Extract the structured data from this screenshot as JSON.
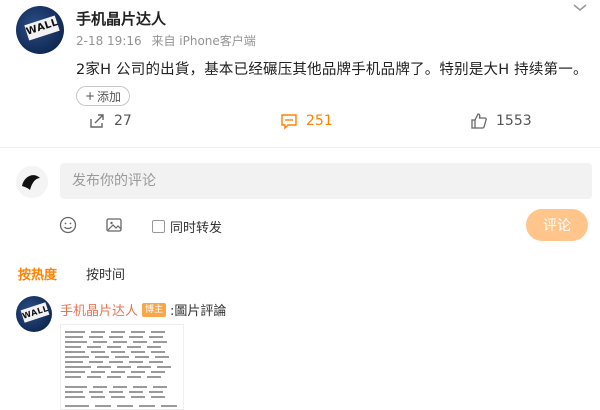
{
  "post": {
    "author": "手机晶片达人",
    "avatar_text": "WALL",
    "time": "2-18 19:16",
    "source": "来自 iPhone客户端",
    "content": "2家H 公司的出貨，基本已经碾压其他品牌手机品牌了。特别是大H 持续第一。",
    "add_label": "添加",
    "add_icon": "+",
    "menu_icon": "chevron-down-icon"
  },
  "actions": {
    "repost_count": "27",
    "comment_count": "251",
    "like_count": "1553",
    "comment_color": "#ff8200"
  },
  "comment_box": {
    "placeholder": "发布你的评论",
    "repost_label": "同时转发",
    "submit_label": "评论",
    "submit_color": "#ffc58a"
  },
  "sort": {
    "hot_label": "按热度",
    "time_label": "按时间",
    "active_color": "#ff8200"
  },
  "reply": {
    "author": "手机晶片达人",
    "avatar_text": "WALL",
    "badge": "博主",
    "text": ":圖片評論"
  }
}
